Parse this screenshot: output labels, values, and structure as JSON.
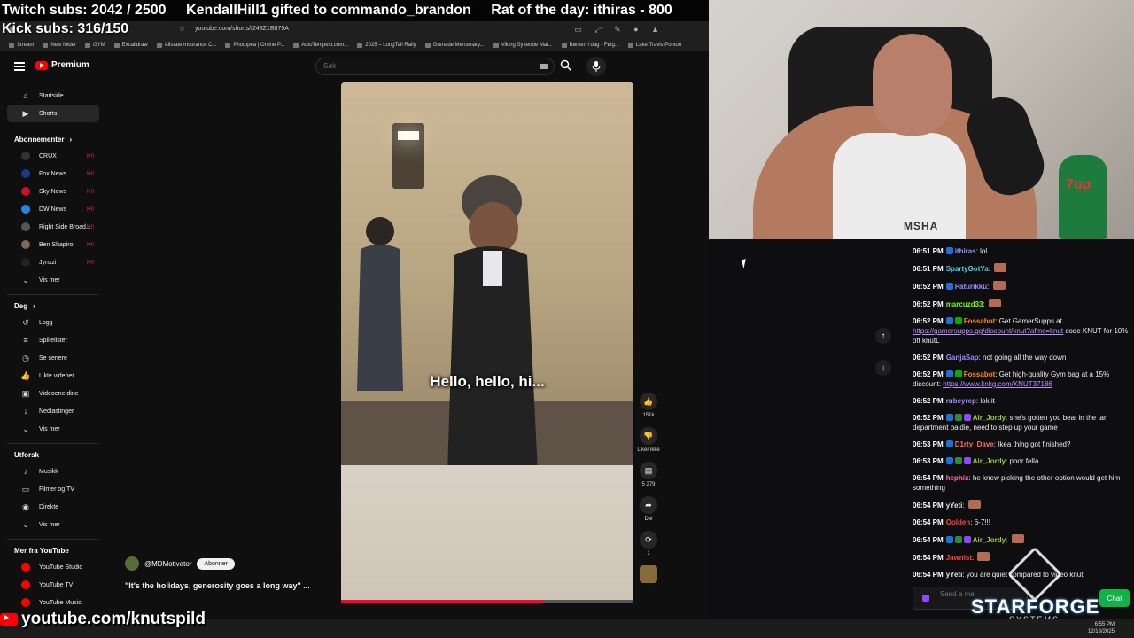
{
  "overlay": {
    "twitch_subs": "Twitch subs: 2042 / 2500",
    "gift": "KendallHill1 gifted to commando_brandon",
    "rat": "Rat of the day: ithiras - 800",
    "kick_subs": "Kick subs: 316/150"
  },
  "browser": {
    "url": "youtube.com/shorts/t248Z1B879A",
    "bookmarks": [
      "Stream",
      "New folder",
      "GYM",
      "Excalidraw",
      "Allstate Insurance C...",
      "Photopea | Online P...",
      "AutoTempest.com...",
      "2025 – LongTail Rally",
      "Grenade Mercenary...",
      "Viking Syttende Mai...",
      "Børsen i dag - Følg...",
      "Lake Travis Pontoo"
    ]
  },
  "youtube": {
    "logo_text": "Premium",
    "search_placeholder": "Søk",
    "nav": [
      {
        "label": "Startside",
        "icon": "home-icon",
        "glyph": "⌂"
      },
      {
        "label": "Shorts",
        "icon": "shorts-icon",
        "glyph": "▶"
      }
    ],
    "subscriptions_header": "Abonnementer",
    "subscriptions": [
      {
        "label": "CRUX",
        "color": "#333333"
      },
      {
        "label": "Fox News",
        "color": "#1b3a8c"
      },
      {
        "label": "Sky News",
        "color": "#c8102e"
      },
      {
        "label": "DW News",
        "color": "#1e88e5"
      },
      {
        "label": "Right Side Broad...",
        "color": "#555555"
      },
      {
        "label": "Ben Shapiro",
        "color": "#7a6a5a"
      },
      {
        "label": "Jynxzi",
        "color": "#222222"
      }
    ],
    "show_more": "Vis mer",
    "you_header": "Deg",
    "you_items": [
      {
        "label": "Logg",
        "glyph": "↺"
      },
      {
        "label": "Spillelister",
        "glyph": "≡"
      },
      {
        "label": "Se senere",
        "glyph": "◷"
      },
      {
        "label": "Likte videoer",
        "glyph": "👍"
      },
      {
        "label": "Videoene dine",
        "glyph": "▣"
      },
      {
        "label": "Nedlastinger",
        "glyph": "↓"
      }
    ],
    "explore_header": "Utforsk",
    "explore_items": [
      {
        "label": "Musikk",
        "glyph": "♪"
      },
      {
        "label": "Filmer og TV",
        "glyph": "▭"
      },
      {
        "label": "Direkte",
        "glyph": "◉"
      }
    ],
    "more_header": "Mer fra YouTube",
    "more_items": [
      "YouTube Studio",
      "YouTube TV",
      "YouTube Music"
    ],
    "video": {
      "caption": "Hello, hello, hi...",
      "channel": "@MDMotivator",
      "subscribe_label": "Abonner",
      "title": "\"It's the holidays, generosity goes a long way\" ...",
      "progress": 0.69
    },
    "actions": {
      "likes": "151k",
      "dislike_label": "Liker ikke",
      "comments": "5 279",
      "share_label": "Del",
      "remix_count": "1"
    }
  },
  "chat": {
    "messages": [
      {
        "time": "06:51 PM",
        "user": "ithiras",
        "color": "#9b8cff",
        "text": "lol",
        "badges": [
          "#1e6fd6"
        ]
      },
      {
        "time": "06:51 PM",
        "user": "SpartyGotYa",
        "color": "#4dd0e1",
        "text": "",
        "badges": []
      },
      {
        "time": "06:52 PM",
        "user": "Paturikku",
        "color": "#9b8cff",
        "text": "",
        "badges": [
          "#1e6fd6"
        ]
      },
      {
        "time": "06:52 PM",
        "user": "marcuzd33",
        "color": "#7cfc00",
        "text": "",
        "badges": []
      },
      {
        "time": "06:52 PM",
        "user": "Fossabot",
        "color": "#ff8c00",
        "text": "Get GamerSupps at",
        "link": "https://gamersupps.gg/discount/knut?afmc=knut",
        "after": "code KNUT for 10% off knutL",
        "badges": [
          "#1e6fd6",
          "#00ad03"
        ]
      },
      {
        "time": "06:52 PM",
        "user": "GanjaSap",
        "color": "#9b8cff",
        "text": "not going all the way down",
        "badges": []
      },
      {
        "time": "06:52 PM",
        "user": "Fossabot",
        "color": "#ff8c00",
        "text": "Get high-quality Gym bag at a 15% discount:",
        "link": "https://www.knkg.com/KNUT37186",
        "after": "",
        "badges": [
          "#1e6fd6",
          "#00ad03"
        ]
      },
      {
        "time": "06:52 PM",
        "user": "rubeyrep",
        "color": "#9b8cff",
        "text": "lok it",
        "badges": []
      },
      {
        "time": "06:52 PM",
        "user": "Air_Jordy",
        "color": "#9acd32",
        "text": "she's gotten you beat in the tan department baldie, need to step up your game",
        "badges": [
          "#1e6fd6",
          "#2b8a3e",
          "#9146ff"
        ]
      },
      {
        "time": "06:53 PM",
        "user": "D1rty_Dave",
        "color": "#ff6a6a",
        "text": "Ikea thing got finished?",
        "badges": [
          "#1e6fd6"
        ]
      },
      {
        "time": "06:53 PM",
        "user": "Air_Jordy",
        "color": "#9acd32",
        "text": "poor fella",
        "badges": [
          "#1e6fd6",
          "#2b8a3e",
          "#9146ff"
        ]
      },
      {
        "time": "06:54 PM",
        "user": "hephix",
        "color": "#ff69b4",
        "text": "he knew picking the other option would get him something",
        "badges": []
      },
      {
        "time": "06:54 PM",
        "user": "yYeti",
        "color": "#e5e5e5",
        "text": "",
        "badges": []
      },
      {
        "time": "06:54 PM",
        "user": "Oolden",
        "color": "#ff4040",
        "text": "6-7!!!",
        "badges": []
      },
      {
        "time": "06:54 PM",
        "user": "Air_Jordy",
        "color": "#9acd32",
        "text": "",
        "badges": [
          "#1e6fd6",
          "#2b8a3e",
          "#9146ff"
        ]
      },
      {
        "time": "06:54 PM",
        "user": "Jawnist",
        "color": "#ff4040",
        "text": "",
        "badges": []
      },
      {
        "time": "06:54 PM",
        "user": "yYeti",
        "color": "#e5e5e5",
        "text": "you are quiet compared to video knut",
        "badges": []
      }
    ],
    "input_placeholder": "Send a message",
    "chat_button": "Chat"
  },
  "webcam": {
    "shirt_text": "MSHA",
    "bottle_text": "7up"
  },
  "branding": {
    "sponsor": "STARFORGE",
    "sponsor_sub": "SYSTEMS",
    "channel_banner": "youtube.com/knutspild"
  },
  "taskbar": {
    "time": "6:55 PM",
    "date": "12/18/2025"
  }
}
